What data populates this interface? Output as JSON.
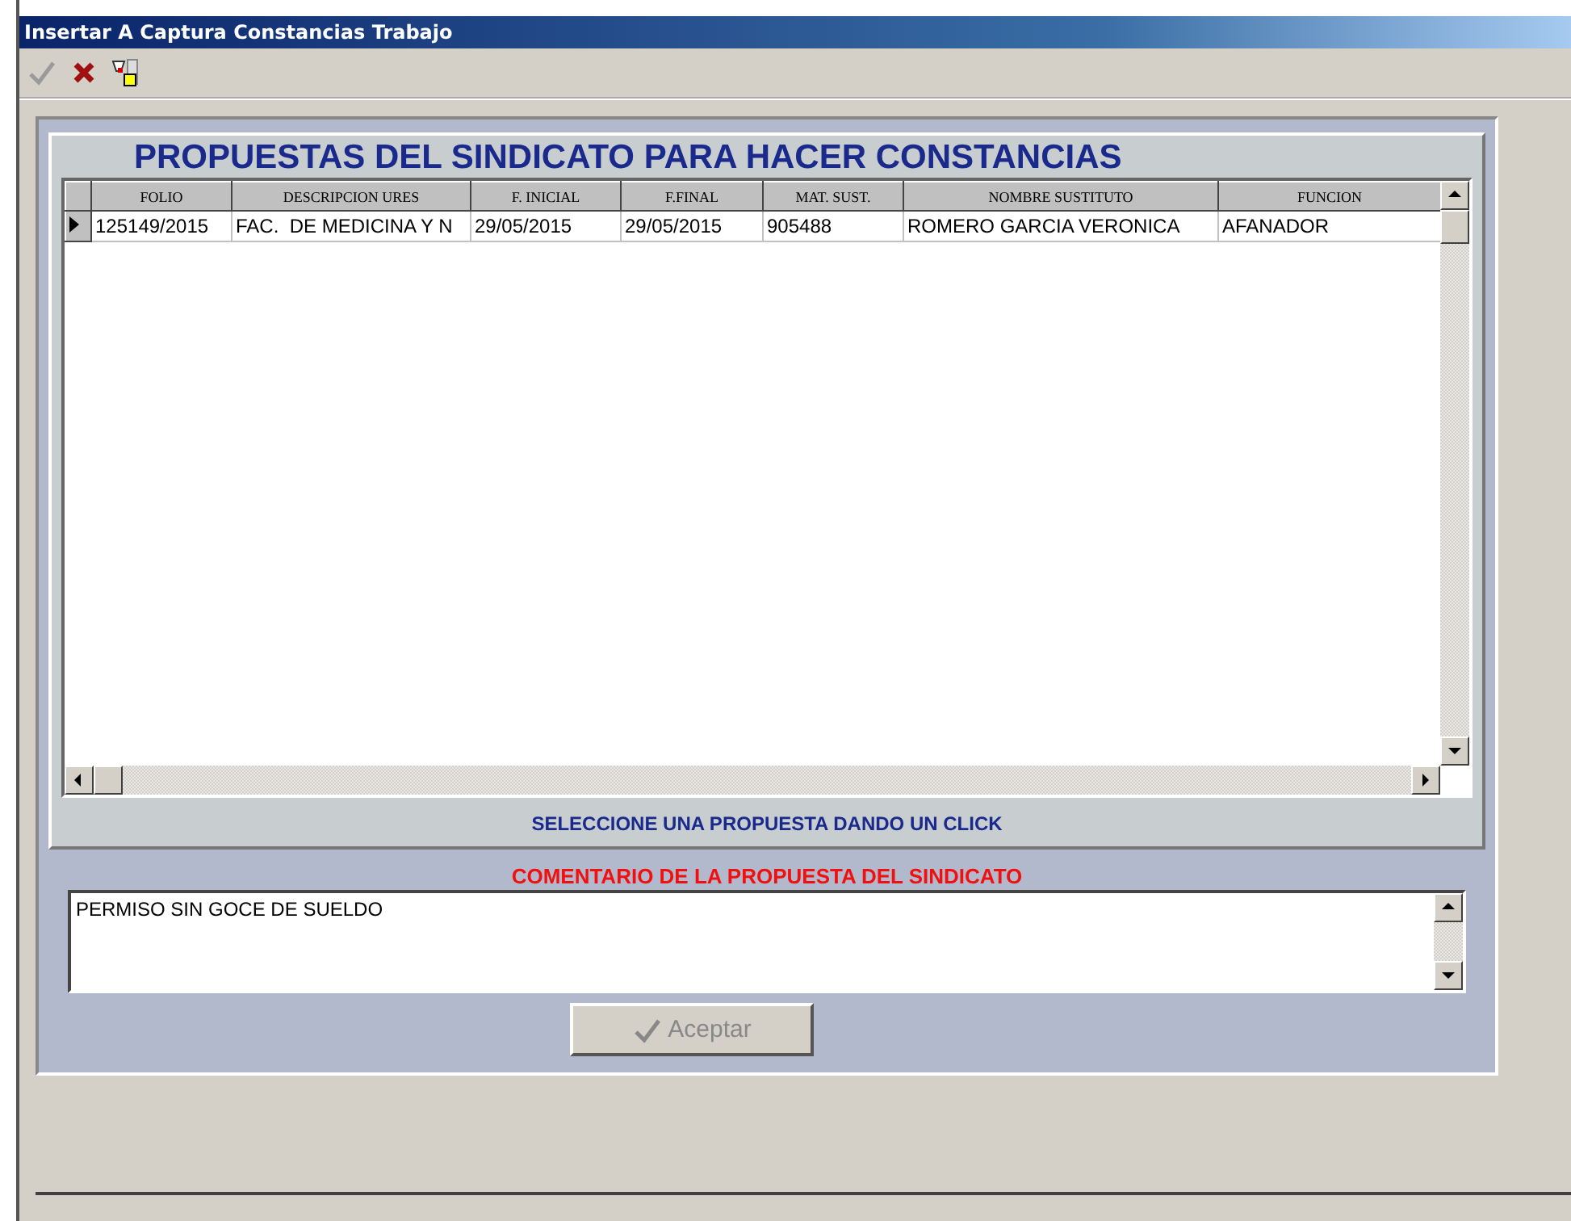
{
  "window": {
    "title": "Insertar A Captura Constancias Trabajo"
  },
  "toolbar": [
    {
      "kind": "check",
      "disabled": true
    },
    {
      "kind": "cross",
      "disabled": false
    },
    {
      "kind": "filter",
      "disabled": false
    }
  ],
  "proposals": {
    "title": "PROPUESTAS DEL SINDICATO PARA HACER CONSTANCIAS",
    "columns": [
      "FOLIO",
      "DESCRIPCION URES",
      "F. INICIAL",
      "F.FINAL",
      "MAT. SUST.",
      "NOMBRE SUSTITUTO",
      "FUNCION"
    ],
    "rows": [
      {
        "selected": true,
        "cells": [
          "125149/2015",
          "FAC.  DE MEDICINA Y N",
          "29/05/2015",
          "29/05/2015",
          "905488",
          "ROMERO GARCIA VERONICA",
          "AFANADOR"
        ]
      }
    ],
    "hint": "SELECCIONE UNA PROPUESTA DANDO UN CLICK"
  },
  "comment": {
    "label": "COMENTARIO DE LA PROPUESTA DEL SINDICATO",
    "value": "PERMISO SIN GOCE DE SUELDO"
  },
  "accept_button": {
    "label": "Aceptar",
    "disabled": true
  }
}
